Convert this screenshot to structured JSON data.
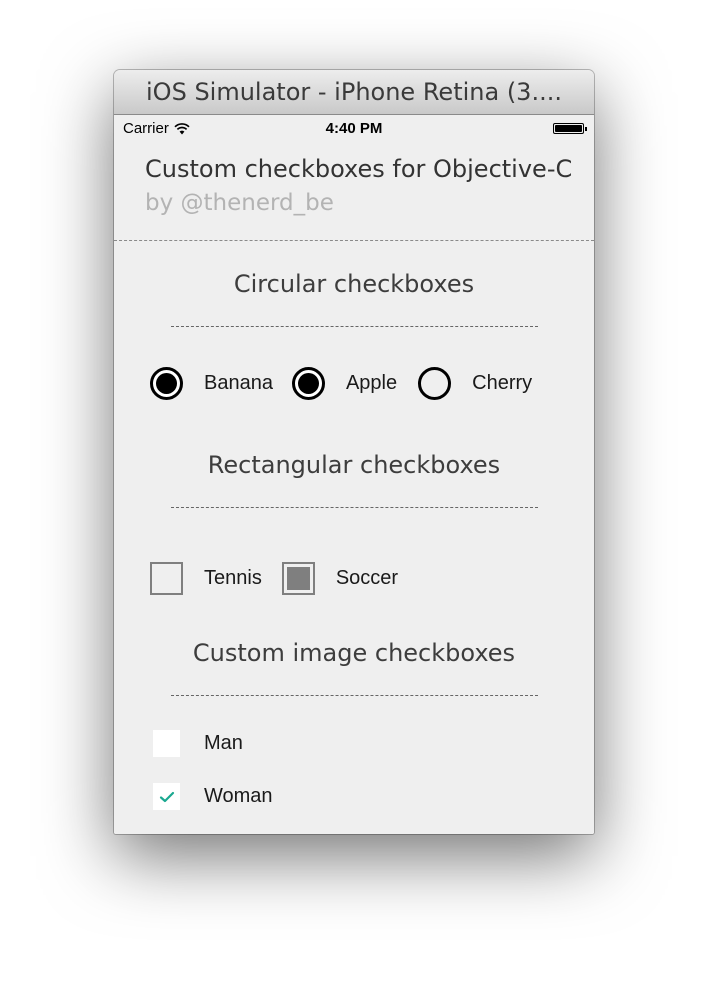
{
  "window": {
    "title": "iOS Simulator - iPhone Retina (3...."
  },
  "status_bar": {
    "carrier": "Carrier",
    "time": "4:40 PM",
    "signal_icon": "wifi-icon",
    "battery_icon": "battery-icon"
  },
  "header": {
    "title": "Custom checkboxes for Objective-C",
    "subtitle": "by @thenerd_be"
  },
  "circular": {
    "title": "Circular checkboxes",
    "options": [
      {
        "label": "Banana",
        "checked": true
      },
      {
        "label": "Apple",
        "checked": true
      },
      {
        "label": "Cherry",
        "checked": false
      }
    ]
  },
  "rectangular": {
    "title": "Rectangular checkboxes",
    "options": [
      {
        "label": "Tennis",
        "checked": false
      },
      {
        "label": "Soccer",
        "checked": true
      }
    ]
  },
  "image": {
    "title": "Custom image checkboxes",
    "options": [
      {
        "label": "Man",
        "checked": false
      },
      {
        "label": "Woman",
        "checked": true
      }
    ]
  },
  "colors": {
    "checkmark": "#1aa890",
    "rect_fill": "#7f7f7f",
    "background": "#efefef"
  }
}
